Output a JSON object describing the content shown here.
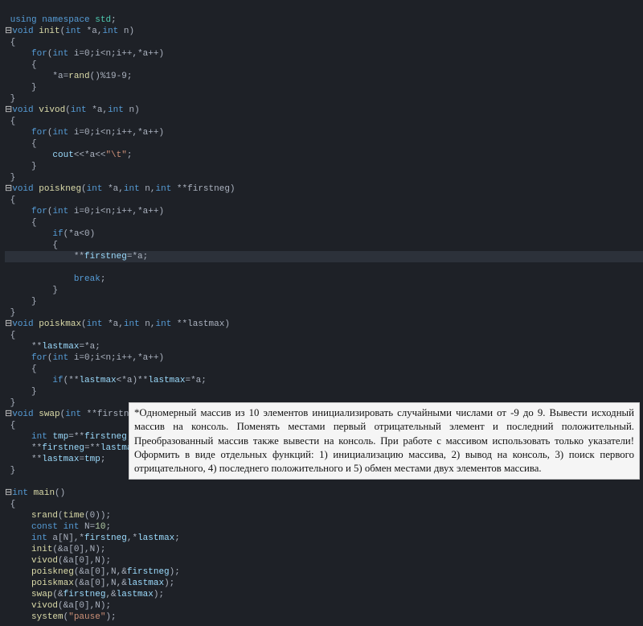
{
  "code": {
    "l1_kw1": "using",
    "l1_kw2": "namespace",
    "l1_ns": "std",
    "l2_kw": "void",
    "l2_fn": "init",
    "l2_sig": "(int *a,int n)",
    "l2_kw_int": "int",
    "for_text": "for(int i=0;i<n;i++,*a++)",
    "kw_for": "for",
    "kw_int": "int",
    "l5_body": "*a=rand()%19-9;",
    "l5_fn_rand": "rand",
    "l5_rest": "()%19-9;",
    "l8_kw": "void",
    "l8_fn": "vivod",
    "l8_sig": "(int *a,int n)",
    "l12_body": "cout<<*a<<\"\\t\";",
    "l12_cout": "cout",
    "l12_str": "\"\\t\"",
    "l14_kw": "void",
    "l14_fn": "poiskneg",
    "l14_sig": "(int *a,int n,int **firstneg)",
    "l18_if": "if(*a<0)",
    "kw_if": "if",
    "l20_stmt": "**firstneg=*a;",
    "l20_id": "firstneg",
    "kw_break": "break",
    "l25_kw": "void",
    "l25_fn": "poiskmax",
    "l25_sig": "(int *a,int n,int **lastmax)",
    "l27_stmt": "**lastmax=*a;",
    "l27_id": "lastmax",
    "l30_stmt": "if(**lastmax<*a)**lastmax=*a;",
    "l33_kw": "void",
    "l33_fn": "swap",
    "l33_sig": "(int **firstneg,int **lastmax)",
    "l35a": "int tmp=**firstneg;",
    "l35_id_tmp": "tmp",
    "l36": "**firstneg=**lastmax;",
    "l37": "**lastmax=tmp;",
    "main_kw": "int",
    "main_fn": "main",
    "m1": "srand(time(0));",
    "m1_fn1": "srand",
    "m1_fn2": "time",
    "m2": "const int N=10;",
    "m2_kw1": "const",
    "m2_kw2": "int",
    "m2_num": "10",
    "m3": "int a[N],*firstneg,*lastmax;",
    "m4": "init(&a[0],N);",
    "m5": "vivod(&a[0],N);",
    "m6": "poiskneg(&a[0],N,&firstneg);",
    "m7": "poiskmax(&a[0],N,&lastmax);",
    "m8": "swap(&firstneg,&lastmax);",
    "m9": "vivod(&a[0],N);",
    "m10": "system(\"pause\");",
    "m10_fn": "system",
    "m10_str": "\"pause\""
  },
  "overlay_text": "*Одномерный массив из 10 элементов инициализировать случайными числами от   -9 до 9. Вывести исходный массив на консоль. Поменять местами первый отрицательный элемент и последний положительный. Преобразованный массив также вывести на консоль. При работе с массивом использовать только указатели! Оформить в виде отдельных функций: 1) инициализацию массива, 2) вывод на консоль, 3) поиск первого отрицательного, 4) последнего положительного и 5) обмен местами двух элементов массива."
}
